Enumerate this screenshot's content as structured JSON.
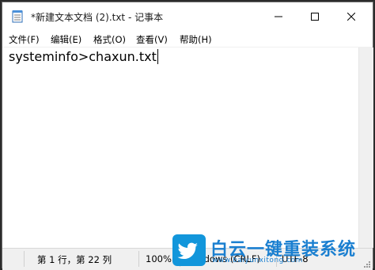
{
  "window": {
    "title": "*新建文本文档 (2).txt - 记事本"
  },
  "menu": {
    "items": [
      {
        "label": "文件(F)"
      },
      {
        "label": "编辑(E)"
      },
      {
        "label": "格式(O)"
      },
      {
        "label": "查看(V)"
      },
      {
        "label": "帮助(H)"
      }
    ]
  },
  "editor": {
    "content": "systeminfo>chaxun.txt"
  },
  "status": {
    "position": "第 1 行，第 22 列",
    "zoom": "100%",
    "line_ending": "Windows (CRLF)",
    "encoding": "UTF-8"
  },
  "watermark": {
    "text": "白云一键重装系统",
    "url": "www.baiyunxitong.com"
  },
  "icons": [
    "notepad-icon",
    "minimize-icon",
    "maximize-icon",
    "close-icon",
    "resize-grip-icon",
    "twitter-bird-logo"
  ]
}
